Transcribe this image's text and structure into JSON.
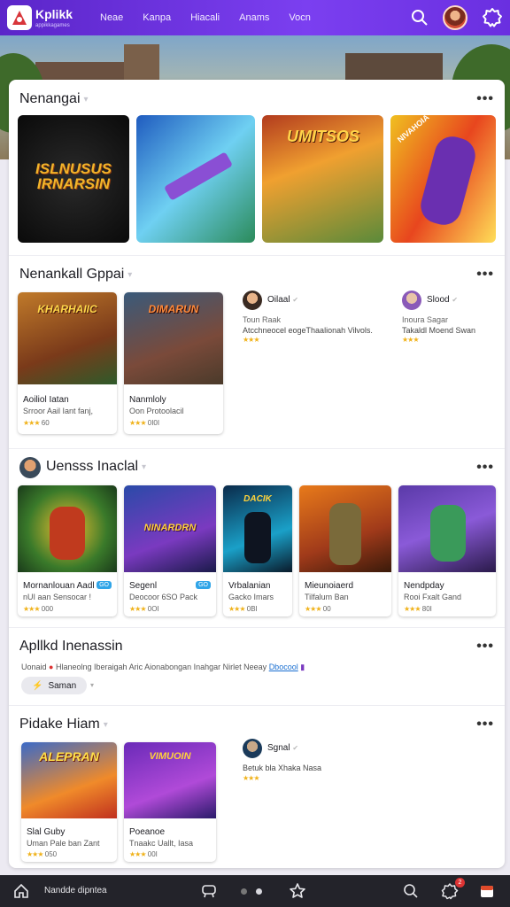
{
  "topbar": {
    "logo_text": "Kplikk",
    "logo_sub": "appikkagames",
    "nav": [
      "Neae",
      "Kanpa",
      "Hiacali",
      "Anams",
      "Vocn"
    ]
  },
  "sections": {
    "s1": {
      "title": "Nenangai"
    },
    "s2": {
      "title": "Nenankall Gppai",
      "cards": [
        {
          "title": "Aoiliol Iatan",
          "sub": "Srroor Aail Iant fanj,",
          "rating": "★★★",
          "count": "60"
        },
        {
          "title": "Nanmloly",
          "sub": "Oon Protoolacil",
          "rating": "★★★",
          "count": "0I0I"
        }
      ],
      "creators": [
        {
          "name": "Oilaal",
          "line1": "Toun Raak",
          "line2": "Atcchneocel eogeThaalionah Vilvols.",
          "rating": "★★★"
        },
        {
          "name": "Slood",
          "line1": "Inoura Sagar",
          "line2": "Takaldl Moend Swan",
          "rating": "★★★"
        }
      ]
    },
    "s3": {
      "title": "Uensss Inaclal",
      "cards": [
        {
          "title": "Mornanlouan Aadl",
          "sub": "nUI aan Sensocar !",
          "rating": "★★★",
          "count": "000",
          "badge": "GO"
        },
        {
          "title": "Segenl",
          "sub": "Deocoor 6SO Pack",
          "rating": "★★★",
          "count": "0OI",
          "badge": "GO"
        },
        {
          "title": "Vrbalanian",
          "sub": "Gacko Imars",
          "rating": "★★★",
          "count": "0BI"
        },
        {
          "title": "Mieunoiaerd",
          "sub": "Tilfalum Ban",
          "rating": "★★★",
          "count": "00"
        },
        {
          "title": "Nendpday",
          "sub": "Rooi Fxalt Gand",
          "rating": "★★★",
          "count": "80I"
        }
      ]
    },
    "s4": {
      "title": "Apllkd Inenassin",
      "text": "Uonaid",
      "text2": "Hlaneolng Iberaigah Aric Aionabongan Inahgar Nirlet Neeay",
      "link": "Dbocool",
      "chip": "Saman"
    },
    "s5": {
      "title": "Pidake Hiam",
      "cards": [
        {
          "title": "Slal Guby",
          "sub": "Uman Pale ban Zant",
          "rating": "★★★",
          "count": "050"
        },
        {
          "title": "Poeanoe",
          "sub": "Tnaakc Uallt, Iasa",
          "rating": "★★★",
          "count": "00I"
        }
      ],
      "creator": {
        "name": "Sgnal",
        "line1": "Betuk bla Xhaka Nasa",
        "rating": "★★★"
      }
    }
  },
  "bottombar": {
    "label": "Nandde dipntea",
    "notif": "2"
  },
  "tile_texts": [
    "ISLNUSUS IRNARSIN",
    "UMITSOS",
    "NIVAHOIA"
  ],
  "card_art_texts": [
    "KHARHAIIC",
    "DIMARUN",
    "NINARDRN",
    "DACIK",
    "ALEPRAN",
    "VIMUOIN"
  ],
  "colors": {
    "brand": "#6b32e6",
    "star": "#f0b21a",
    "link": "#1a6fd1"
  }
}
